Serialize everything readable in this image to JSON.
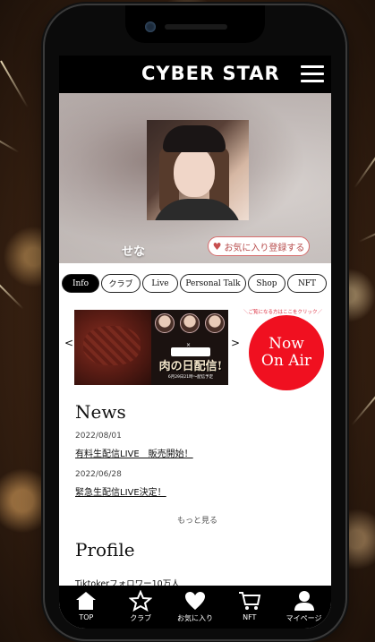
{
  "app": {
    "logo": "CYBER STAR"
  },
  "hero": {
    "name": "せな",
    "favorite_button": "お気に入り登録する"
  },
  "tabs": [
    {
      "label": "Info",
      "active": true
    },
    {
      "label": "クラブ"
    },
    {
      "label": "Live"
    },
    {
      "label": "Personal Talk"
    },
    {
      "label": "Shop"
    },
    {
      "label": "NFT"
    }
  ],
  "banner": {
    "title": "肉の日配信!",
    "subtitle": "6月29日21時〜配信予定",
    "cross": "×",
    "prev": "<",
    "next": ">"
  },
  "on_air": {
    "hint": "＼ご覧になる方はここをクリック／",
    "line1": "Now",
    "line2": "On Air",
    "color": "#f01020"
  },
  "news": {
    "title": "News",
    "items": [
      {
        "date": "2022/08/01",
        "text": "有料生配信LIVE　販売開始！"
      },
      {
        "date": "2022/06/28",
        "text": "緊急生配信LIVE決定！"
      }
    ],
    "more": "もっと見る"
  },
  "profile": {
    "title": "Profile",
    "text": "Tiktokerフォロワー10万人"
  },
  "bottom_nav": [
    {
      "label": "TOP",
      "icon": "home-icon"
    },
    {
      "label": "クラブ",
      "icon": "star-icon"
    },
    {
      "label": "お気に入り",
      "icon": "heart-icon"
    },
    {
      "label": "NFT",
      "icon": "cart-icon"
    },
    {
      "label": "マイページ",
      "icon": "user-icon"
    }
  ]
}
